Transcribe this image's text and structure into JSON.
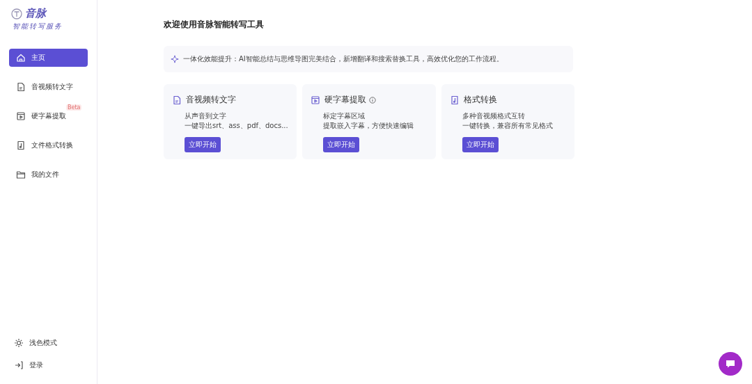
{
  "logo": {
    "name": "音脉",
    "tagline": "智能转写服务"
  },
  "sidebar": {
    "items": [
      {
        "label": "主页",
        "kind": "home",
        "selected": true
      },
      {
        "label": "音视频转文字",
        "kind": "doc",
        "selected": false
      },
      {
        "label": "硬字幕提取",
        "kind": "video",
        "selected": false,
        "badge": "Beta"
      },
      {
        "label": "文件格式转换",
        "kind": "music",
        "selected": false
      },
      {
        "label": "我的文件",
        "kind": "folder",
        "selected": false
      }
    ],
    "footer": [
      {
        "label": "浅色模式",
        "kind": "sun"
      },
      {
        "label": "登录",
        "kind": "login"
      }
    ]
  },
  "main": {
    "title": "欢迎使用音脉智能转写工具",
    "banner": "一体化效能提升：AI智能总结与思维导图完美结合，新增翻译和搜索替换工具，高效优化您的工作流程。",
    "cards": [
      {
        "title": "音视频转文字",
        "kind": "doc",
        "info": false,
        "lines": [
          "从声音到文字",
          "一键导出srt、ass、pdf、docs..."
        ],
        "button": "立即开始"
      },
      {
        "title": "硬字幕提取",
        "kind": "video",
        "info": true,
        "lines": [
          "标定字幕区域",
          "提取嵌入字幕，方便快速编辑"
        ],
        "button": "立即开始"
      },
      {
        "title": "格式转换",
        "kind": "music",
        "info": false,
        "lines": [
          "多种音视频格式互转",
          "一键转换，兼容所有常见格式"
        ],
        "button": "立即开始"
      }
    ]
  }
}
